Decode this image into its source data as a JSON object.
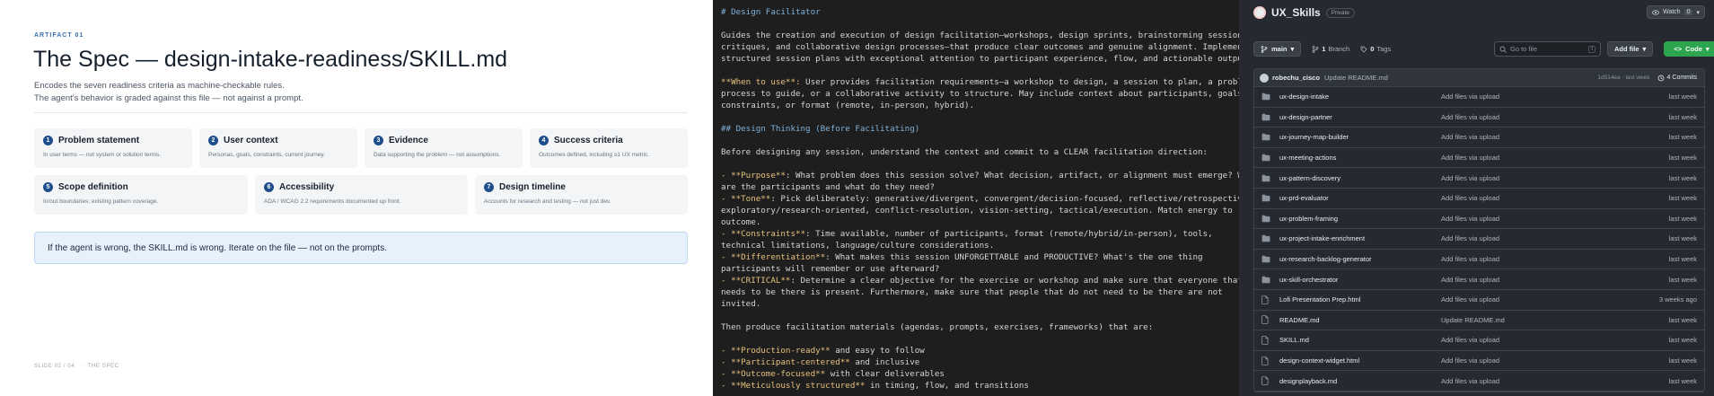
{
  "slide": {
    "artifact_label": "ARTIFACT 01",
    "title": "The Spec — design-intake-readiness/SKILL.md",
    "subtitle_1": "Encodes the seven readiness criteria as machine-checkable rules.",
    "subtitle_2": "The agent's behavior is graded against this file — not against a prompt.",
    "criteria": [
      {
        "num": "1",
        "title": "Problem statement",
        "desc": "In user terms — not system or solution terms."
      },
      {
        "num": "2",
        "title": "User context",
        "desc": "Personas, goals, constraints, current journey."
      },
      {
        "num": "3",
        "title": "Evidence",
        "desc": "Data supporting the problem — not assumptions."
      },
      {
        "num": "4",
        "title": "Success criteria",
        "desc": "Outcomes defined, including ≥1 UX metric."
      },
      {
        "num": "5",
        "title": "Scope definition",
        "desc": "In/out boundaries; existing pattern coverage."
      },
      {
        "num": "6",
        "title": "Accessibility",
        "desc": "ADA / WCAG 2.2 requirements documented up front."
      },
      {
        "num": "7",
        "title": "Design timeline",
        "desc": "Accounts for research and testing — not just dev."
      }
    ],
    "callout": "If the agent is wrong, the SKILL.md is wrong. Iterate on the file — not on the prompts.",
    "footer_slide": "SLIDE 02 / 04",
    "footer_sep": "·",
    "footer_section": "THE SPEC"
  },
  "editor": {
    "line_01": "# Design Facilitator",
    "line_03": "Guides the creation and execution of design facilitation—workshops, design sprints, brainstorming sessions,",
    "line_04": "critiques, and collaborative design processes—that produce clear outcomes and genuine alignment. Implement",
    "line_05": "structured session plans with exceptional attention to participant experience, flow, and actionable outputs.",
    "line_07a": "**When to use**:",
    "line_07b": " User provides facilitation requirements—a workshop to design, a session to plan, a problem",
    "line_08": "process to guide, or a collaborative activity to structure. May include context about participants, goals,",
    "line_09": "constraints, or format (remote, in-person, hybrid).",
    "line_11": "## Design Thinking (Before Facilitating)",
    "line_13": "Before designing any session, understand the context and commit to a CLEAR facilitation direction:",
    "line_15a": "- **Purpose**",
    "line_15b": ": What problem does this session solve? What decision, artifact, or alignment must emerge? Who",
    "line_16": "are the participants and what do they need?",
    "line_17a": "- **Tone**",
    "line_17b": ": Pick deliberately: generative/divergent, convergent/decision-focused, reflective/retrospective,",
    "line_18": "exploratory/research-oriented, conflict-resolution, vision-setting, tactical/execution. Match energy to",
    "line_19": "outcome.",
    "line_20a": "- **Constraints**",
    "line_20b": ": Time available, number of participants, format (remote/hybrid/in-person), tools,",
    "line_21": "technical limitations, language/culture considerations.",
    "line_22a": "- **Differentiation**",
    "line_22b": ": What makes this session UNFORGETTABLE and PRODUCTIVE? What's the one thing",
    "line_23": "participants will remember or use afterward?",
    "line_24a": "- **CRITICAL**",
    "line_24b": ": Determine a clear objective for the exercise or workshop and make sure that everyone that",
    "line_25": "needs to be there is present. Furthermore, make sure that people that do not need to be there are not",
    "line_26": "invited.",
    "line_28": "Then produce facilitation materials (agendas, prompts, exercises, frameworks) that are:",
    "line_30a": "- **Production-ready**",
    "line_30b": " and easy to follow",
    "line_31a": "- **Participant-centered**",
    "line_31b": " and inclusive",
    "line_32a": "- **Outcome-focused**",
    "line_32b": " with clear deliverables",
    "line_33a": "- **Meticulously structured**",
    "line_33b": " in timing, flow, and transitions"
  },
  "github": {
    "repo_name": "UX_Skills",
    "visibility": "Private",
    "watch_label": "Watch",
    "watch_count": "0",
    "branch": "main",
    "branch_count": "1",
    "branch_label": "Branch",
    "tag_count": "0",
    "tag_label": "Tags",
    "goto_placeholder": "Go to file",
    "goto_kbd": "t",
    "add_file": "Add file",
    "code": "Code",
    "commit_user": "robechu_cisco",
    "commit_msg": "Update README.md",
    "commit_hash_time": "1d514ea · last week",
    "commit_count": "4 Commits",
    "files": [
      {
        "type": "folder",
        "name": "ux-design-intake",
        "msg": "Add files via upload",
        "time": "last week"
      },
      {
        "type": "folder",
        "name": "ux-design-partner",
        "msg": "Add files via upload",
        "time": "last week"
      },
      {
        "type": "folder",
        "name": "ux-journey-map-builder",
        "msg": "Add files via upload",
        "time": "last week"
      },
      {
        "type": "folder",
        "name": "ux-meeting-actions",
        "msg": "Add files via upload",
        "time": "last week"
      },
      {
        "type": "folder",
        "name": "ux-pattern-discovery",
        "msg": "Add files via upload",
        "time": "last week"
      },
      {
        "type": "folder",
        "name": "ux-prd-evaluator",
        "msg": "Add files via upload",
        "time": "last week"
      },
      {
        "type": "folder",
        "name": "ux-problem-framing",
        "msg": "Add files via upload",
        "time": "last week"
      },
      {
        "type": "folder",
        "name": "ux-project-intake-enrichment",
        "msg": "Add files via upload",
        "time": "last week"
      },
      {
        "type": "folder",
        "name": "ux-research-backlog-generator",
        "msg": "Add files via upload",
        "time": "last week"
      },
      {
        "type": "folder",
        "name": "ux-skill-orchestrator",
        "msg": "Add files via upload",
        "time": "last week"
      },
      {
        "type": "file",
        "name": "Lofi Presentation Prep.html",
        "msg": "Add files via upload",
        "time": "3 weeks ago"
      },
      {
        "type": "file",
        "name": "README.md",
        "msg": "Update README.md",
        "time": "last week"
      },
      {
        "type": "file",
        "name": "SKILL.md",
        "msg": "Add files via upload",
        "time": "last week"
      },
      {
        "type": "file",
        "name": "design-context-widget.html",
        "msg": "Add files via upload",
        "time": "last week"
      },
      {
        "type": "file",
        "name": "designplayback.md",
        "msg": "Add files via upload",
        "time": "last week"
      }
    ]
  }
}
